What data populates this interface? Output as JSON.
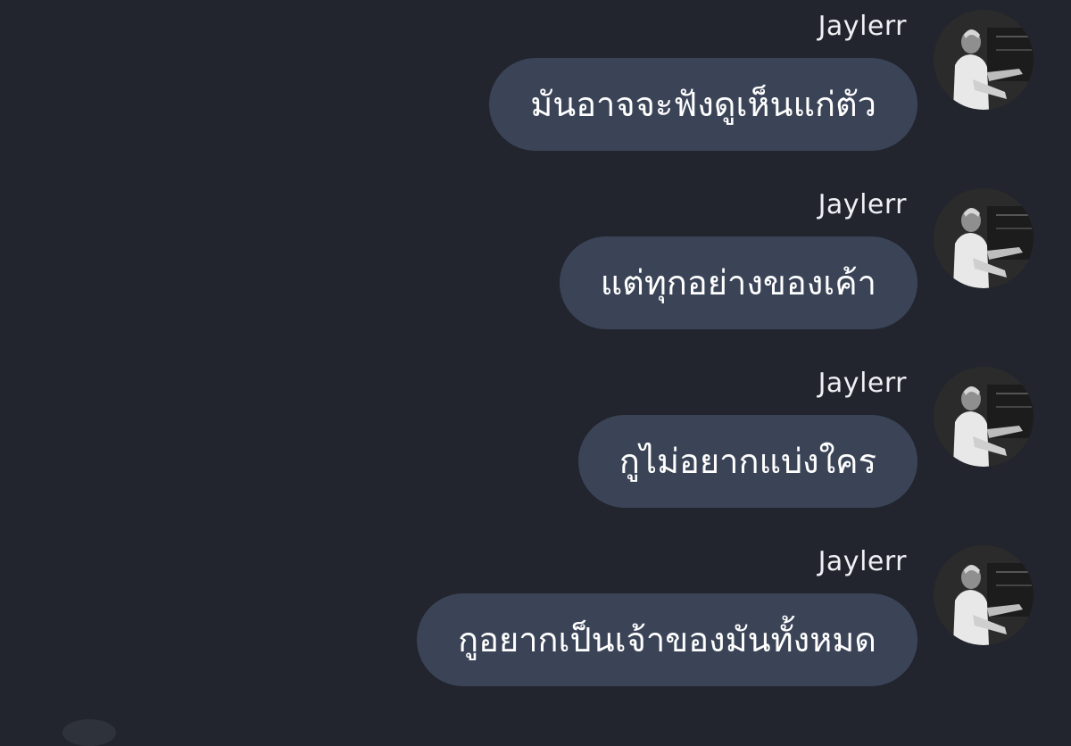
{
  "conversation": {
    "messages": [
      {
        "sender": "Jaylerr",
        "text": "มันอาจจะฟังดูเห็นแก่ตัว",
        "avatar_icon": "user-photo-avatar"
      },
      {
        "sender": "Jaylerr",
        "text": "แต่ทุกอย่างของเค้า",
        "avatar_icon": "user-photo-avatar"
      },
      {
        "sender": "Jaylerr",
        "text": "กูไม่อยากแบ่งใคร",
        "avatar_icon": "user-photo-avatar"
      },
      {
        "sender": "Jaylerr",
        "text": "กูอยากเป็นเจ้าของมันทั้งหมด",
        "avatar_icon": "user-photo-avatar"
      }
    ]
  },
  "colors": {
    "background": "#22252e",
    "bubble": "#3b4457",
    "text": "#ffffff"
  }
}
